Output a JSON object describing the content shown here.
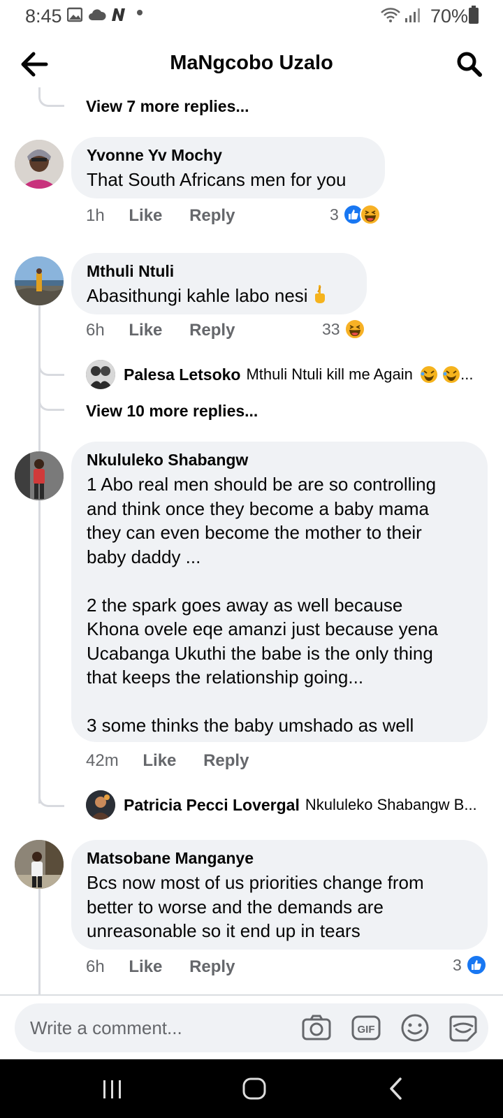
{
  "status_bar": {
    "time": "8:45",
    "battery": "70%"
  },
  "header": {
    "title": "MaNgcobo Uzalo"
  },
  "thread_top": {
    "more_replies": "View 7 more replies..."
  },
  "comments": [
    {
      "author": "Yvonne Yv Mochy",
      "text": "That South Africans men for you",
      "time": "1h",
      "like": "Like",
      "reply": "Reply",
      "reaction_count": "3"
    },
    {
      "author": "Mthuli Ntuli",
      "text": "Abasithungi kahle labo nesi",
      "time": "6h",
      "like": "Like",
      "reply": "Reply",
      "reaction_count": "33",
      "reply_preview": {
        "author": "Palesa Letsoko",
        "text": "Mthuli Ntuli kill me Again"
      },
      "more_replies": "View 10 more replies..."
    },
    {
      "author": "Nkululeko Shabangw",
      "text": "1 Abo real men should be are so controlling\nand think once they become a baby mama\nthey can even become the mother to their\nbaby daddy ...\n\n2 the spark goes away as well because\nKhona ovele eqe amanzi just because yena\nUcabanga Ukuthi the babe is the only thing\nthat keeps the relationship going...\n\n3 some thinks the baby umshado as well",
      "time": "42m",
      "like": "Like",
      "reply": "Reply",
      "reply_preview": {
        "author": "Patricia Pecci Lovergal",
        "text": "Nkululeko Shabangw B..."
      }
    },
    {
      "author": "Matsobane Manganye",
      "text": "Bcs now most of us priorities change from\nbetter to worse and the demands are\nunreasonable so it end up in tears",
      "time": "6h",
      "like": "Like",
      "reply": "Reply",
      "reaction_count": "3"
    }
  ],
  "composer": {
    "placeholder": "Write a comment...",
    "tools": [
      "camera-icon",
      "gif-icon",
      "emoji-icon",
      "sticker-icon"
    ]
  },
  "colors": {
    "like_blue": "#1877f2",
    "haha_yellow": "#f7b125",
    "bubble": "#f0f2f5",
    "meta_gray": "#65676b"
  }
}
